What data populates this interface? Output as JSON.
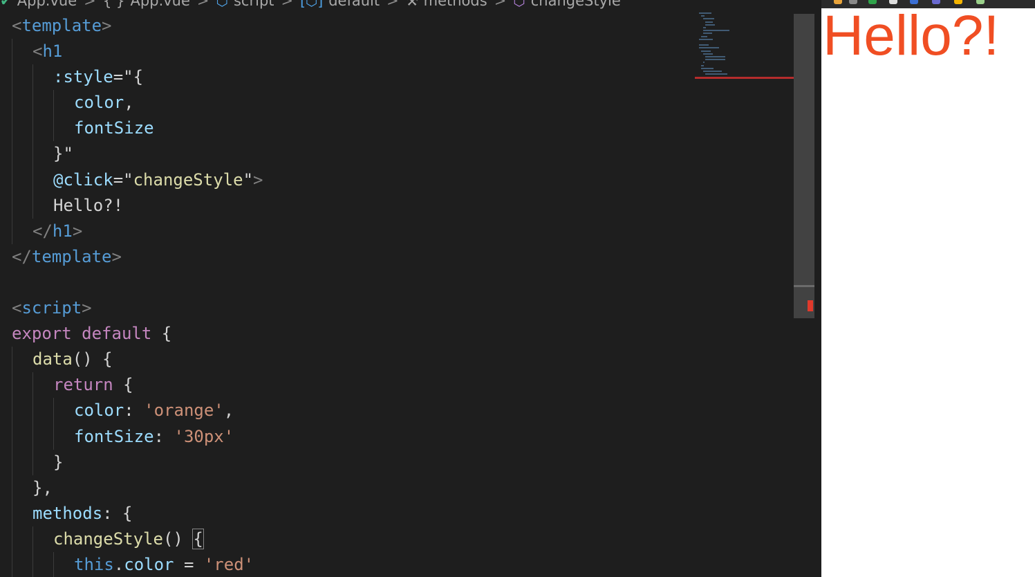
{
  "breadcrumb": {
    "items": [
      {
        "icon": "vue-icon",
        "label": "App.vue"
      },
      {
        "icon": "braces-icon",
        "label": "App.vue"
      },
      {
        "icon": "cube-icon",
        "label": "script"
      },
      {
        "icon": "namespace-icon",
        "label": "default"
      },
      {
        "icon": "wrench-icon",
        "label": "methods"
      },
      {
        "icon": "method-cube-icon",
        "label": "changeStyle"
      }
    ],
    "separator": ">"
  },
  "code": {
    "lines": [
      [
        {
          "t": "punct",
          "v": "<"
        },
        {
          "t": "tag",
          "v": "template"
        },
        {
          "t": "punct",
          "v": ">"
        }
      ],
      [
        {
          "t": "punct",
          "v": "<"
        },
        {
          "t": "tag",
          "v": "h1"
        }
      ],
      [
        {
          "t": "attr",
          "v": ":style"
        },
        {
          "t": "txt",
          "v": "=\"{"
        }
      ],
      [
        {
          "t": "var",
          "v": "color"
        },
        {
          "t": "txt",
          "v": ","
        }
      ],
      [
        {
          "t": "var",
          "v": "fontSize"
        }
      ],
      [
        {
          "t": "txt",
          "v": "}\""
        }
      ],
      [
        {
          "t": "attr",
          "v": "@click"
        },
        {
          "t": "txt",
          "v": "=\""
        },
        {
          "t": "fn",
          "v": "changeStyle"
        },
        {
          "t": "txt",
          "v": "\""
        },
        {
          "t": "punct",
          "v": ">"
        }
      ],
      [
        {
          "t": "txt",
          "v": "Hello?!"
        }
      ],
      [
        {
          "t": "punct",
          "v": "</"
        },
        {
          "t": "tag",
          "v": "h1"
        },
        {
          "t": "punct",
          "v": ">"
        }
      ],
      [
        {
          "t": "punct",
          "v": "</"
        },
        {
          "t": "tag",
          "v": "template"
        },
        {
          "t": "punct",
          "v": ">"
        }
      ],
      [],
      [
        {
          "t": "punct",
          "v": "<"
        },
        {
          "t": "tag",
          "v": "script"
        },
        {
          "t": "punct",
          "v": ">"
        }
      ],
      [
        {
          "t": "kw",
          "v": "export"
        },
        {
          "t": "txt",
          "v": " "
        },
        {
          "t": "kw",
          "v": "default"
        },
        {
          "t": "txt",
          "v": " {"
        }
      ],
      [
        {
          "t": "fn",
          "v": "data"
        },
        {
          "t": "txt",
          "v": "() {"
        }
      ],
      [
        {
          "t": "kw",
          "v": "return"
        },
        {
          "t": "txt",
          "v": " {"
        }
      ],
      [
        {
          "t": "prop",
          "v": "color"
        },
        {
          "t": "txt",
          "v": ": "
        },
        {
          "t": "str",
          "v": "'orange'"
        },
        {
          "t": "txt",
          "v": ","
        }
      ],
      [
        {
          "t": "prop",
          "v": "fontSize"
        },
        {
          "t": "txt",
          "v": ": "
        },
        {
          "t": "str",
          "v": "'30px'"
        }
      ],
      [
        {
          "t": "txt",
          "v": "}"
        }
      ],
      [
        {
          "t": "txt",
          "v": "},"
        }
      ],
      [
        {
          "t": "prop",
          "v": "methods"
        },
        {
          "t": "txt",
          "v": ": {"
        }
      ],
      [
        {
          "t": "fn",
          "v": "changeStyle"
        },
        {
          "t": "txt",
          "v": "() "
        },
        {
          "t": "match",
          "v": "{"
        }
      ],
      [
        {
          "t": "this",
          "v": "this"
        },
        {
          "t": "txt",
          "v": "."
        },
        {
          "t": "prop",
          "v": "color"
        },
        {
          "t": "txt",
          "v": " = "
        },
        {
          "t": "str",
          "v": "'red'"
        }
      ]
    ],
    "indents": [
      0,
      1,
      2,
      3,
      3,
      2,
      2,
      2,
      1,
      0,
      0,
      0,
      0,
      1,
      2,
      3,
      3,
      2,
      1,
      1,
      2,
      3
    ]
  },
  "preview": {
    "heading": "Hello?!",
    "heading_color": "#f04e23"
  },
  "colors": {
    "editor_bg": "#1e1e1e",
    "tag": "#569cd6",
    "attr": "#9cdcfe",
    "string": "#ce9178",
    "keyword": "#c586c0",
    "function": "#dcdcaa"
  }
}
